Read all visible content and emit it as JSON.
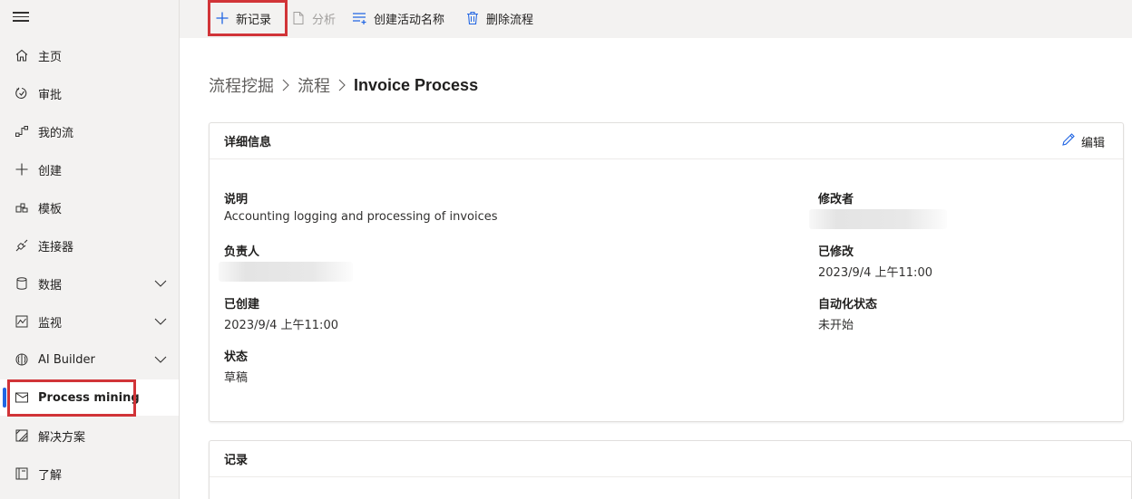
{
  "sidebar": {
    "items": [
      {
        "label": "主页",
        "icon": "home-icon"
      },
      {
        "label": "审批",
        "icon": "approvals-icon"
      },
      {
        "label": "我的流",
        "icon": "flows-icon"
      },
      {
        "label": "创建",
        "icon": "plus-icon"
      },
      {
        "label": "模板",
        "icon": "templates-icon"
      },
      {
        "label": "连接器",
        "icon": "connectors-icon"
      },
      {
        "label": "数据",
        "icon": "database-icon"
      },
      {
        "label": "监视",
        "icon": "monitor-icon"
      },
      {
        "label": "AI Builder",
        "icon": "ai-builder-icon"
      },
      {
        "label": "Process mining",
        "icon": "process-mining-icon"
      },
      {
        "label": "解决方案",
        "icon": "solutions-icon"
      },
      {
        "label": "了解",
        "icon": "learn-icon"
      }
    ],
    "selected": "Process mining",
    "accent_color": "#2266e3"
  },
  "toolbar": {
    "new_record": "新记录",
    "analyze": "分析",
    "create_activity_names": "创建活动名称",
    "delete_process": "删除流程"
  },
  "breadcrumb": {
    "level1": "流程挖掘",
    "level2": "流程",
    "current": "Invoice Process"
  },
  "details": {
    "title": "详细信息",
    "edit_label": "编辑",
    "description_label": "说明",
    "description_value": "Accounting logging and processing of invoices",
    "owner_label": "负责人",
    "created_label": "已创建",
    "created_value": "2023/9/4 上午11:00",
    "status_label": "状态",
    "status_value": "草稿",
    "modified_by_label": "修改者",
    "modified_label": "已修改",
    "modified_value": "2023/9/4 上午11:00",
    "automation_status_label": "自动化状态",
    "automation_status_value": "未开始"
  },
  "records": {
    "title": "记录"
  },
  "highlight_color": "#d13438"
}
